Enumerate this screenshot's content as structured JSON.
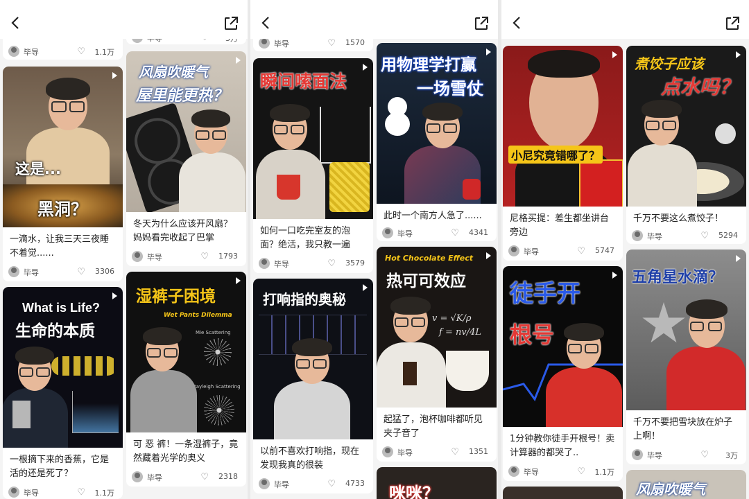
{
  "user": "毕导",
  "panels": [
    {
      "col1_top": {
        "likes": "1.1万"
      },
      "col2_top": {
        "likes": "3万"
      },
      "col1": [
        {
          "title": "一滴水，让我三天三夜睡不着觉......",
          "overlay1": "这是...",
          "overlay2": "黑洞？",
          "likes": "3306"
        },
        {
          "title": "一根摘下来的香蕉，它是活的还是死了？",
          "overlay1": "What is Life?",
          "overlay2": "生命的本质",
          "likes": "1.1万"
        }
      ],
      "col2": [
        {
          "title": "冬天为什么应该开风扇？妈妈看完收起了巴掌",
          "overlay1": "风扇吹暖气",
          "overlay2": "屋里能更热？",
          "likes": "1793"
        },
        {
          "title": "可 恶 裤！一条湿裤子，竟然藏着光学的奥义",
          "overlay1": "湿裤子困境",
          "overlay2": "Wet Pants Dilemma",
          "labels": [
            "Mie Scattering",
            "Rayleigh Scattering"
          ],
          "likes": "2318"
        }
      ]
    },
    {
      "col1_top": {
        "likes": "1570"
      },
      "col1": [
        {
          "title": "如何一口吃完室友的泡面？绝活，我只教一遍",
          "overlay1": "瞬间嗦面法",
          "likes": "3579"
        },
        {
          "title": "以前不喜欢打响指，现在发现我真的很装",
          "overlay1": "打响指的奥秘",
          "likes": "4733"
        }
      ],
      "col2": [
        {
          "title": "此时一个南方人急了......",
          "overlay1": "用物理学打赢",
          "overlay2": "一场雪仗",
          "likes": "4341"
        },
        {
          "title": "起猛了，泡杯咖啡都听见夹子音了",
          "overlay1": "Hot Chocolate Effect",
          "overlay2": "热可可效应",
          "formula1": "v = √K/ρ",
          "formula2": "f = nv/4L",
          "likes": "1351"
        },
        {
          "overlay1": "咪咪？"
        }
      ]
    },
    {
      "col1": [
        {
          "title": "尼格买提：差生都坐讲台旁边",
          "overlay1": "小尼究竟错哪了？",
          "likes": "5747"
        },
        {
          "title": "1分钟教你徒手开根号！卖计算器的都哭了..",
          "overlay1": "徒手开",
          "overlay2": "根号",
          "likes": "1.1万"
        }
      ],
      "col2": [
        {
          "title": "千万不要这么煮饺子！",
          "overlay1": "煮饺子应该",
          "overlay2": "点水吗？",
          "likes": "5294"
        },
        {
          "title": "千万不要把雪块放在炉子上啊！",
          "overlay1": "五角星水滴？",
          "likes": "3万"
        },
        {
          "overlay1": "风扇吹暖气"
        }
      ]
    }
  ],
  "colors": {
    "accent": "#f5c518",
    "red": "#e53935",
    "blue": "#1e4fd8"
  },
  "icons": [
    "back-icon",
    "share-icon",
    "heart-icon",
    "play-icon"
  ]
}
